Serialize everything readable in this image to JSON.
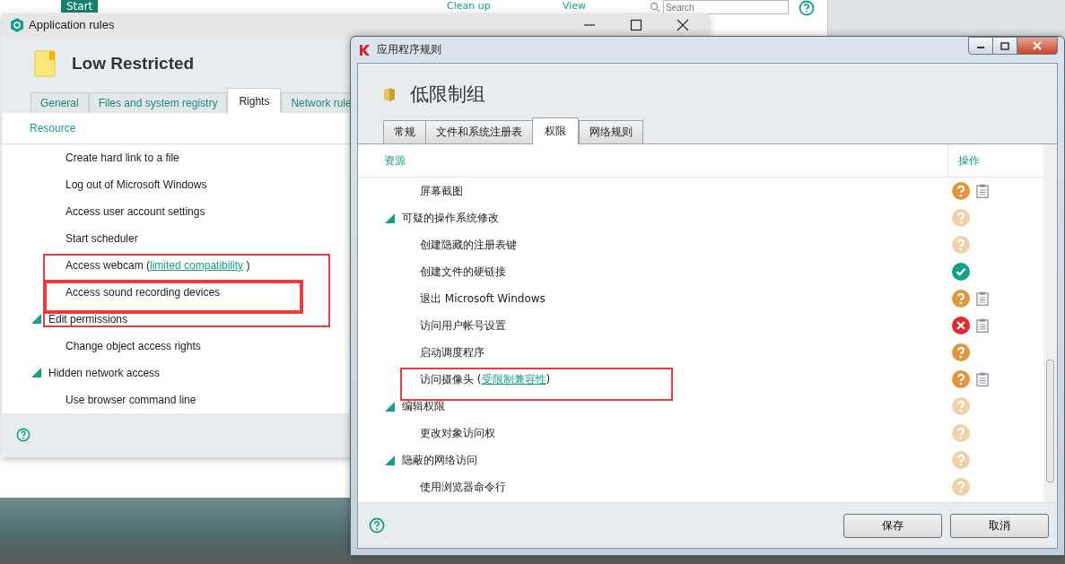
{
  "background_app": {
    "nav_item": "Start",
    "toolbar": [
      "Clean up",
      "View"
    ],
    "search": {
      "placeholder": "Search"
    }
  },
  "left_window": {
    "title": "Application rules",
    "group_name": "Low Restricted",
    "tabs": [
      {
        "label": "General",
        "selected": false
      },
      {
        "label": "Files and system registry",
        "selected": false
      },
      {
        "label": "Rights",
        "selected": true
      },
      {
        "label": "Network rule",
        "selected": false
      }
    ],
    "column": "Resource",
    "rows": [
      {
        "label": "Create hard link to a file",
        "highlighted": false,
        "emphasized": false
      },
      {
        "label": "Log out of Microsoft Windows",
        "highlighted": false,
        "emphasized": false
      },
      {
        "label": "Access user account settings",
        "highlighted": false,
        "emphasized": false
      },
      {
        "label": "Start scheduler",
        "highlighted": false,
        "emphasized": false
      },
      {
        "label": "Access webcam (",
        "link": "limited compatibility",
        "label_end": ")",
        "highlighted": true,
        "emphasized": false
      },
      {
        "label": "Access sound recording devices",
        "highlighted": true,
        "emphasized": true
      },
      {
        "label": "Edit permissions",
        "expanded": true,
        "highlighted": false,
        "emphasized": false,
        "children": [
          {
            "label": "Change object access rights",
            "highlighted": false,
            "emphasized": false
          }
        ]
      },
      {
        "label": "Hidden network access",
        "expanded": true,
        "highlighted": false,
        "emphasized": false,
        "children": [
          {
            "label": "Use browser command line",
            "highlighted": false,
            "emphasized": false
          }
        ]
      }
    ]
  },
  "right_window": {
    "title": "应用程序规则",
    "group_name": "低限制组",
    "tabs": [
      {
        "label": "常规",
        "selected": false
      },
      {
        "label": "文件和系统注册表",
        "selected": false
      },
      {
        "label": "权限",
        "selected": true
      },
      {
        "label": "网络规则",
        "selected": false
      }
    ],
    "columns": [
      "资源",
      "操作"
    ],
    "rows": [
      {
        "label": "屏幕截图",
        "kind": "ask",
        "inherited": false,
        "log": true,
        "highlighted": false
      },
      {
        "label": "可疑的操作系统修改",
        "expanded": true,
        "kind": "ask",
        "inherited": true,
        "log": false,
        "highlighted": false,
        "children": [
          {
            "label": "创建隐藏的注册表键",
            "kind": "ask",
            "inherited": true,
            "log": false,
            "highlighted": false
          },
          {
            "label": "创建文件的硬链接",
            "kind": "allow",
            "inherited": false,
            "log": false,
            "highlighted": false
          },
          {
            "label": "退出 Microsoft Windows",
            "kind": "ask",
            "inherited": false,
            "log": true,
            "highlighted": false
          },
          {
            "label": "访问用户帐号设置",
            "kind": "block",
            "inherited": false,
            "log": true,
            "highlighted": false
          },
          {
            "label": "启动调度程序",
            "kind": "ask",
            "inherited": false,
            "log": false,
            "highlighted": false
          },
          {
            "label": "访问摄像头 (",
            "link": "受限制兼容性",
            "label_end": ")",
            "kind": "ask",
            "inherited": false,
            "log": true,
            "highlighted": true
          }
        ]
      },
      {
        "label": "编辑权限",
        "expanded": true,
        "kind": "ask",
        "inherited": true,
        "log": false,
        "highlighted": false,
        "children": [
          {
            "label": "更改对象访问权",
            "kind": "ask",
            "inherited": true,
            "log": false,
            "highlighted": false
          }
        ]
      },
      {
        "label": "隐蔽的网络访问",
        "expanded": true,
        "kind": "ask",
        "inherited": true,
        "log": false,
        "highlighted": false,
        "children": [
          {
            "label": "使用浏览器命令行",
            "kind": "ask",
            "inherited": true,
            "log": false,
            "highlighted": false
          }
        ]
      }
    ],
    "buttons": [
      "保存",
      "取消"
    ]
  }
}
